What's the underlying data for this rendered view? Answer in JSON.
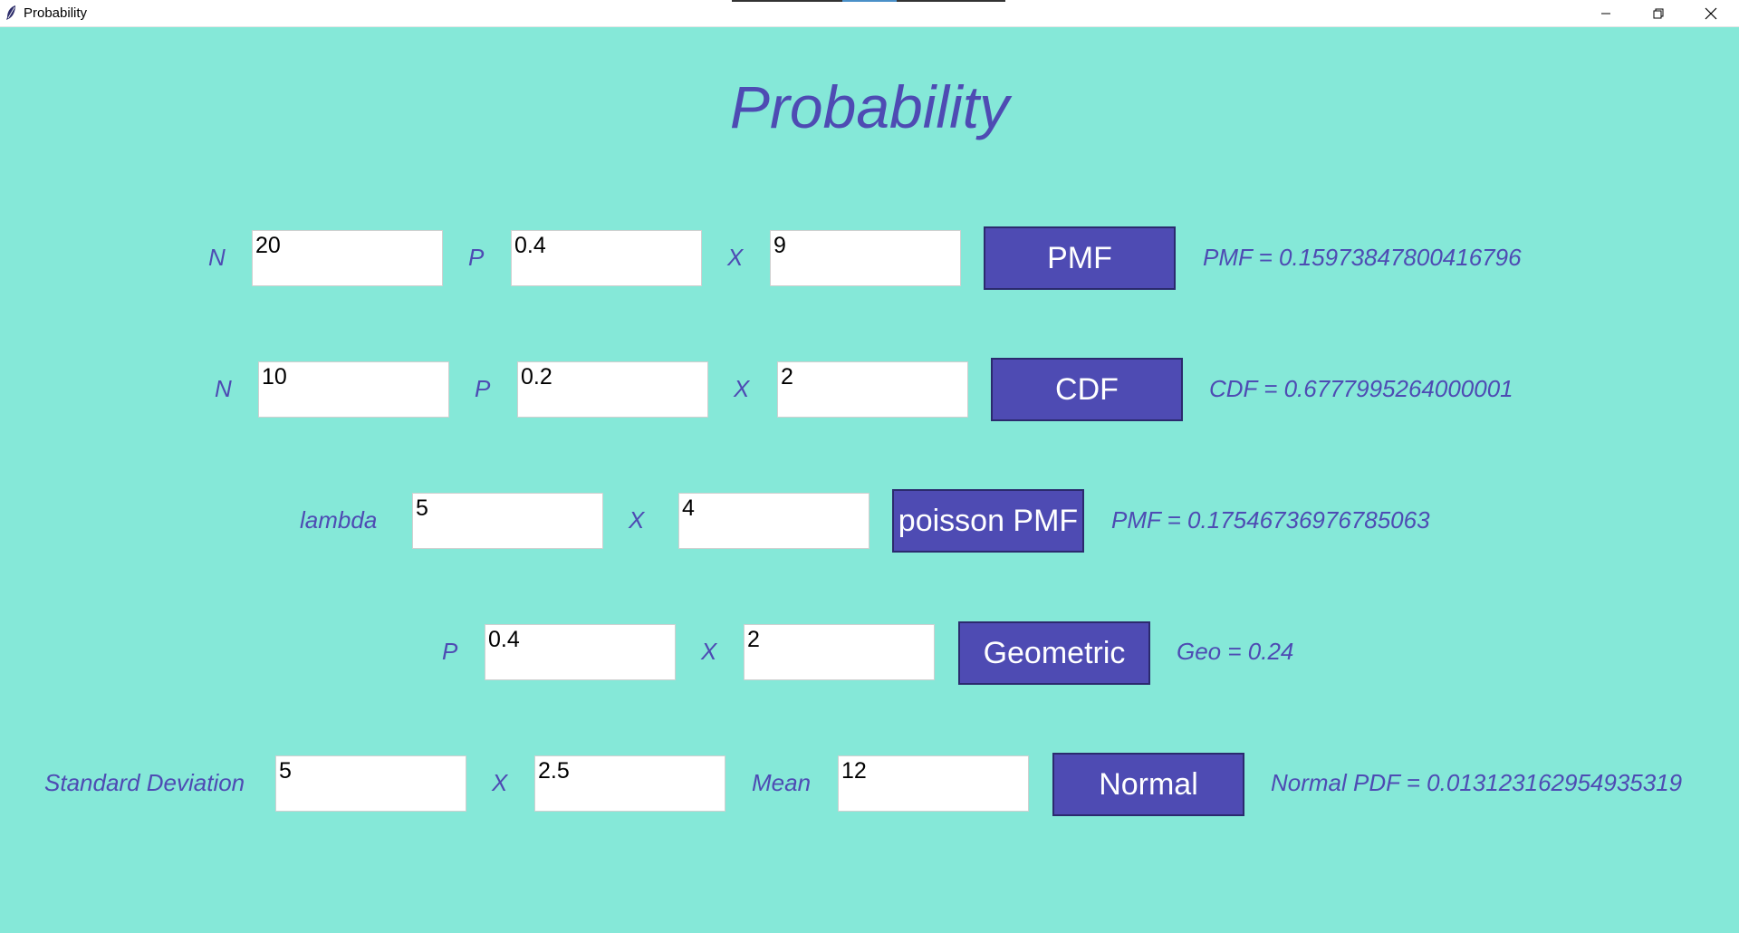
{
  "window": {
    "title": "Probability"
  },
  "app_title": "Probability",
  "rows": {
    "binom_pmf": {
      "n_label": "N",
      "n_value": "20",
      "p_label": "P",
      "p_value": "0.4",
      "x_label": "X",
      "x_value": "9",
      "button": "PMF",
      "result": "PMF = 0.15973847800416796"
    },
    "binom_cdf": {
      "n_label": "N",
      "n_value": "10",
      "p_label": "P",
      "p_value": "0.2",
      "x_label": "X",
      "x_value": "2",
      "button": "CDF",
      "result": "CDF = 0.6777995264000001"
    },
    "poisson": {
      "lambda_label": "lambda",
      "lambda_value": "5",
      "x_label": "X",
      "x_value": "4",
      "button": "poisson PMF",
      "result": "PMF = 0.17546736976785063"
    },
    "geometric": {
      "p_label": "P",
      "p_value": "0.4",
      "x_label": "X",
      "x_value": "2",
      "button": "Geometric",
      "result": "Geo = 0.24"
    },
    "normal": {
      "sd_label": "Standard Deviation",
      "sd_value": "5",
      "x_label": "X",
      "x_value": "2.5",
      "mean_label": "Mean",
      "mean_value": "12",
      "button": "Normal",
      "result": "Normal PDF = 0.013123162954935319"
    }
  },
  "colors": {
    "background": "#85e8d8",
    "accent": "#4e4bb3",
    "button_text": "#ffffff"
  },
  "icons": {
    "app": "feather-icon",
    "minimize": "minimize-icon",
    "maximize": "restore-icon",
    "close": "close-icon"
  }
}
